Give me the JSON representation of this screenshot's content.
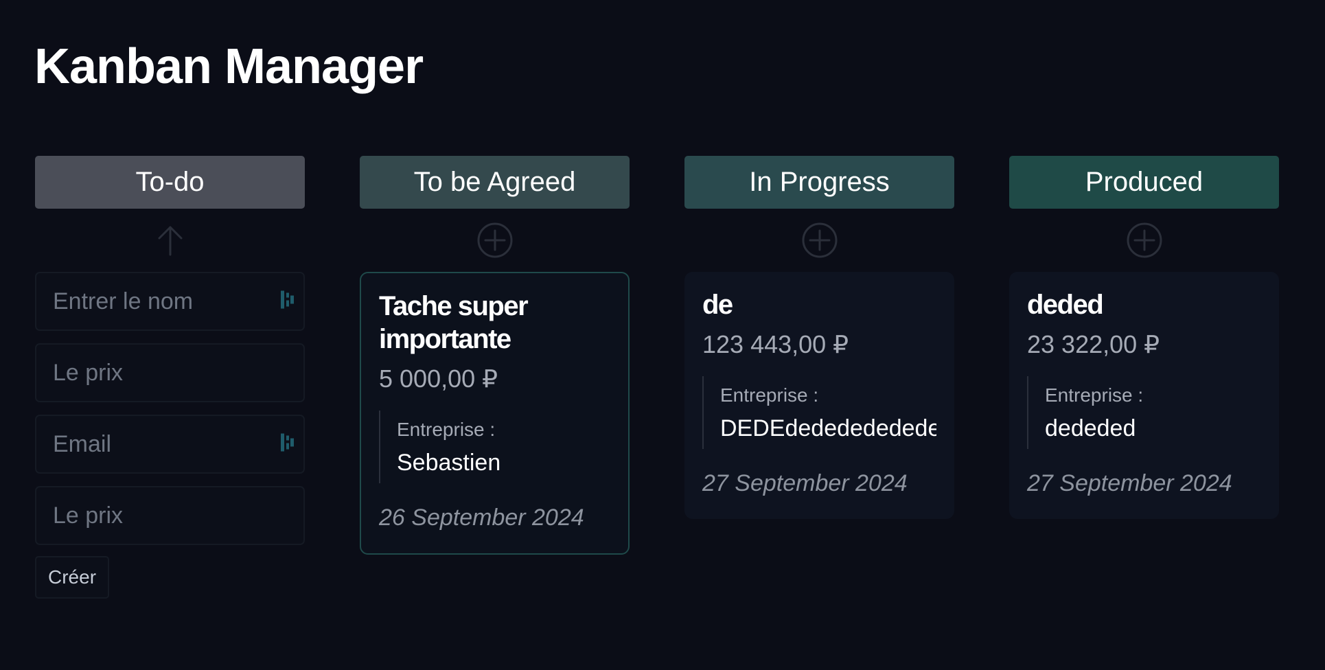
{
  "app": {
    "title": "Kanban Manager"
  },
  "columns": [
    {
      "title": "To-do",
      "color": "#4b4e58",
      "action_icon": "arrow-up-icon"
    },
    {
      "title": "To be Agreed",
      "color": "#34494d",
      "action_icon": "plus-circle-icon"
    },
    {
      "title": "In Progress",
      "color": "#2a4a4e",
      "action_icon": "plus-circle-icon"
    },
    {
      "title": "Produced",
      "color": "#1f4a47",
      "action_icon": "plus-circle-icon"
    }
  ],
  "form": {
    "name_placeholder": "Entrer le nom",
    "price_placeholder": "Le prix",
    "email_placeholder": "Email",
    "price2_placeholder": "Le prix",
    "addon_icon": "autofill-icon",
    "addon_color": "#1f5c6b",
    "create_label": "Créer"
  },
  "cards": [
    {
      "title": "Tache super importante",
      "price": "5 000,00 ₽",
      "company_label": "Entreprise :",
      "company": "Sebastien",
      "date": "26 September 2024"
    },
    {
      "title": "de",
      "price": "123 443,00 ₽",
      "company_label": "Entreprise :",
      "company": "DEDEdedededededed",
      "date": "27 September 2024"
    },
    {
      "title": "deded",
      "price": "23 322,00 ₽",
      "company_label": "Entreprise :",
      "company": "dededed",
      "date": "27 September 2024"
    }
  ]
}
